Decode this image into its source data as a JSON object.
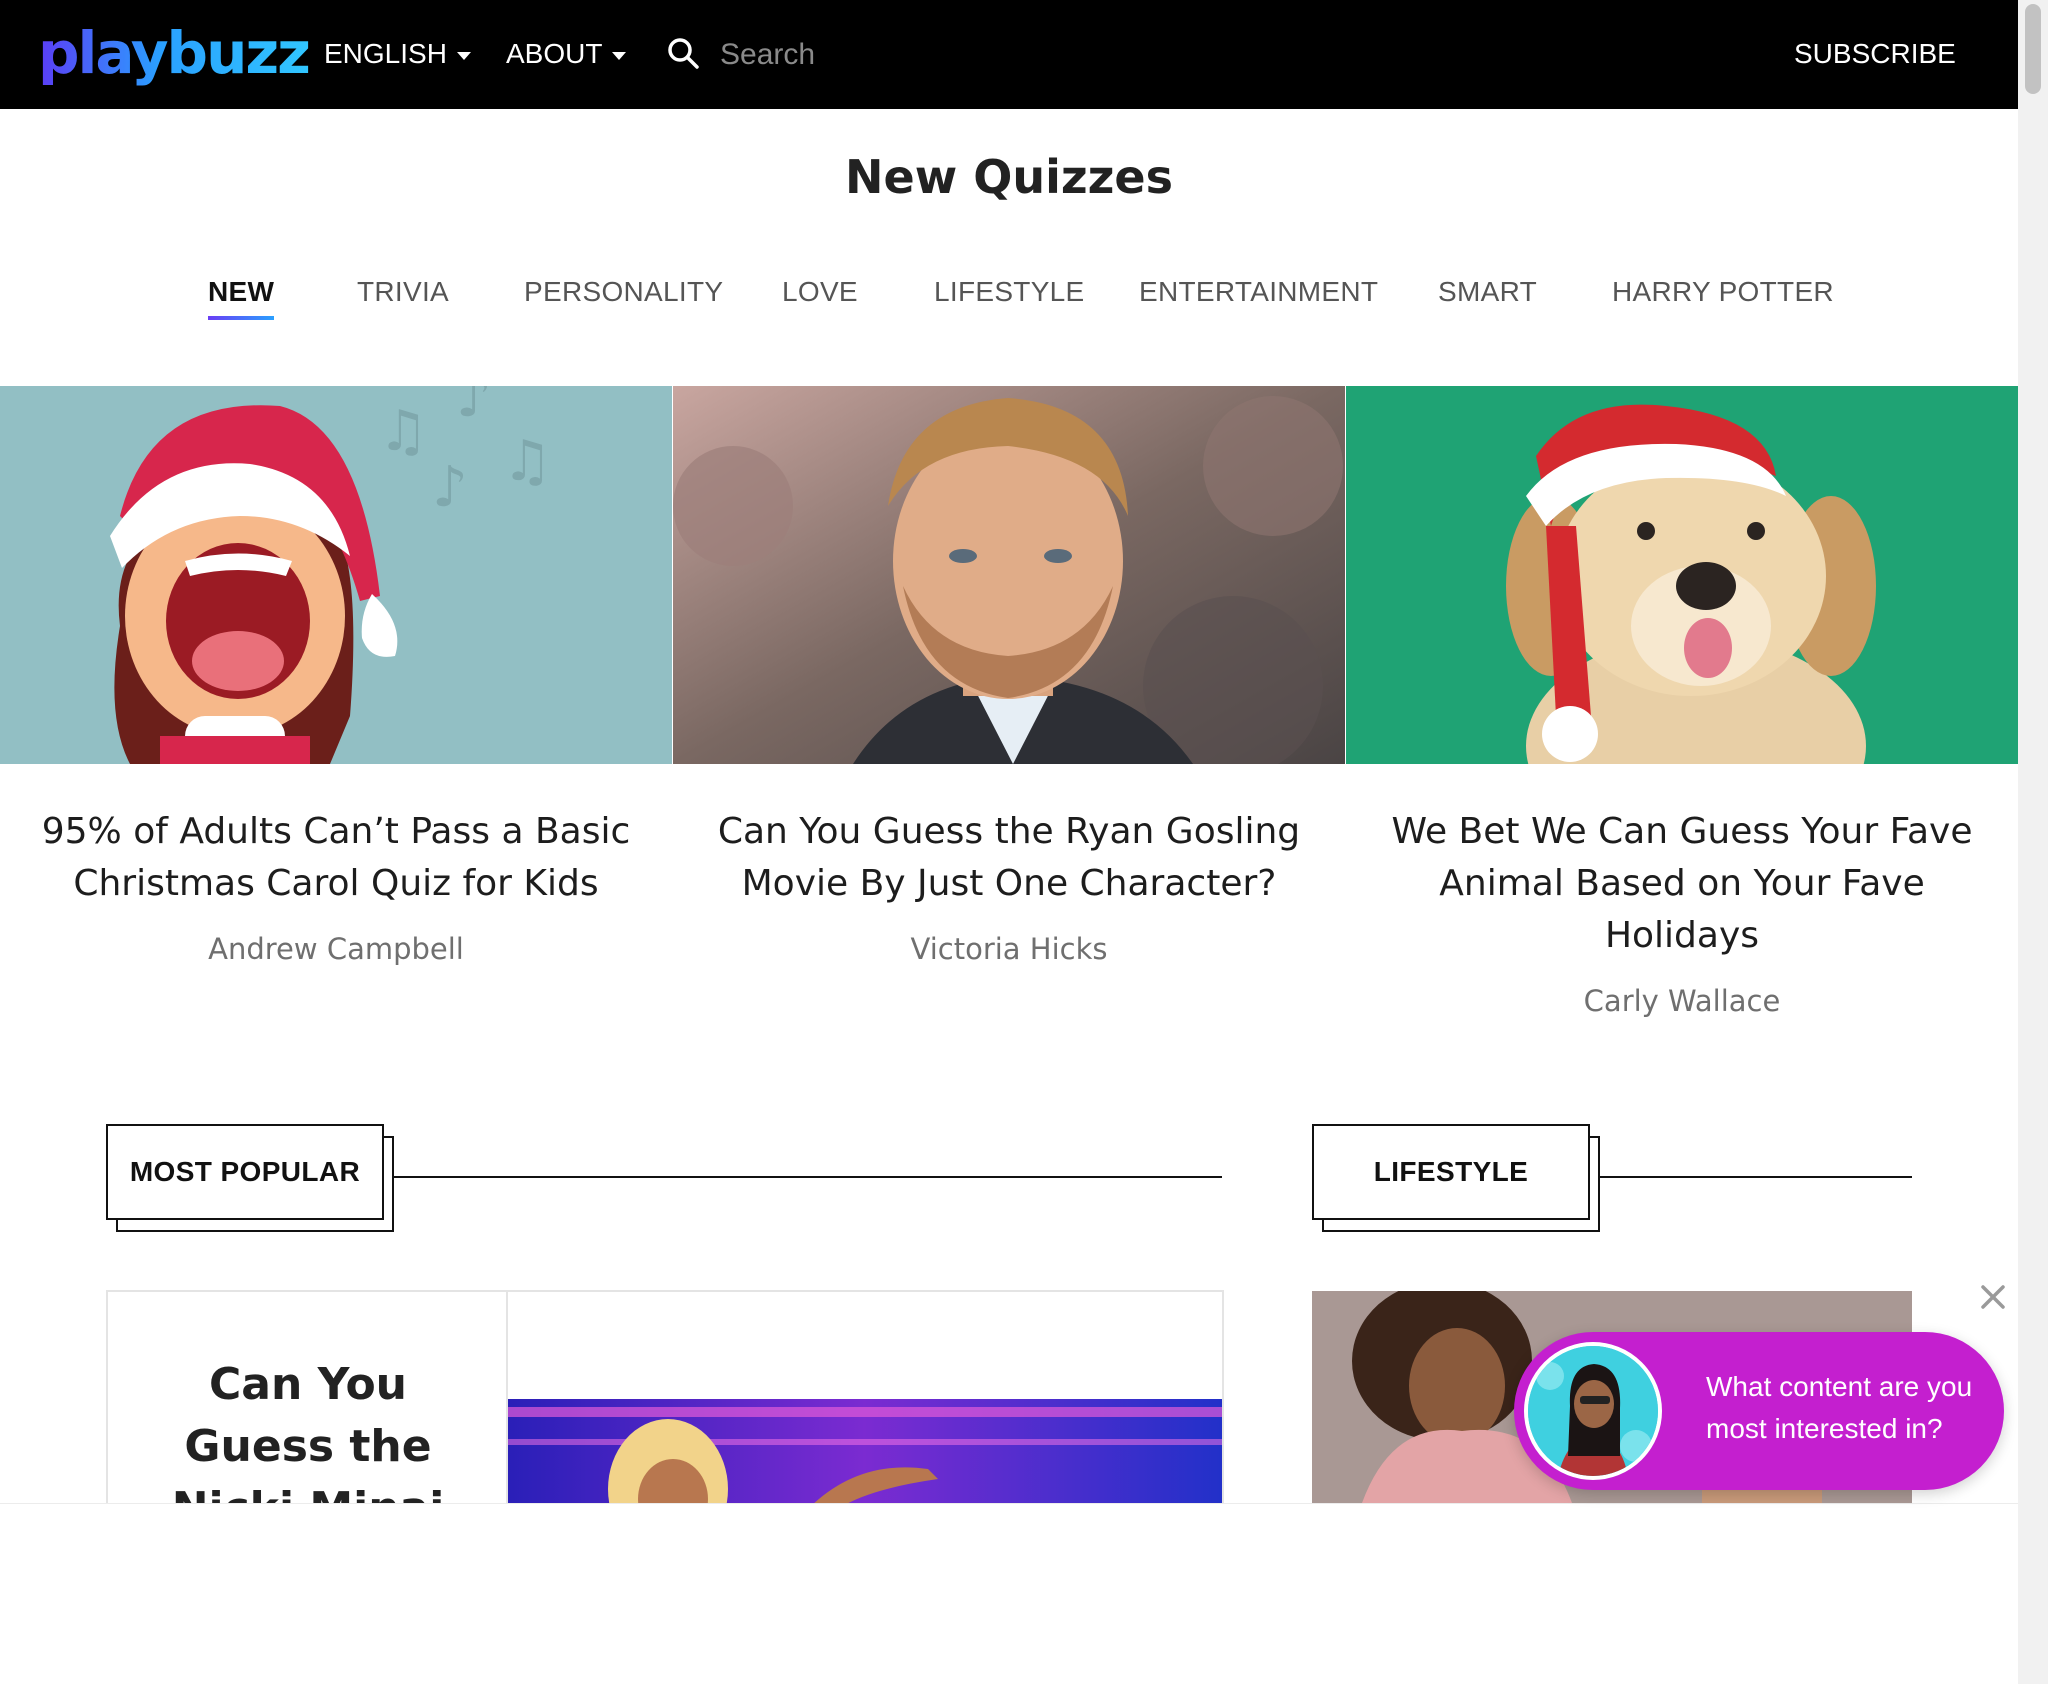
{
  "nav": {
    "logo": "playbuzz",
    "language_label": "ENGLISH",
    "about_label": "ABOUT",
    "search_placeholder": "Search",
    "subscribe_label": "SUBSCRIBE"
  },
  "page_title": "New Quizzes",
  "tabs": [
    {
      "label": "NEW",
      "active": true
    },
    {
      "label": "TRIVIA"
    },
    {
      "label": "PERSONALITY"
    },
    {
      "label": "LOVE"
    },
    {
      "label": "LIFESTYLE"
    },
    {
      "label": "ENTERTAINMENT"
    },
    {
      "label": "SMART"
    },
    {
      "label": "HARRY POTTER"
    }
  ],
  "cards": [
    {
      "title": "95% of Adults Can’t Pass a Basic Christmas Carol Quiz for Kids",
      "author": "Andrew Campbell"
    },
    {
      "title": "Can You Guess the Ryan Gosling Movie By Just One Character?",
      "author": "Victoria Hicks"
    },
    {
      "title": "We Bet We Can Guess Your Fave Animal Based on Your Fave Holidays",
      "author": "Carly Wallace"
    }
  ],
  "sections": {
    "popular_label": "MOST POPULAR",
    "lifestyle_label": "LIFESTYLE"
  },
  "popular_card": {
    "title": "Can You Guess the Nicki Minaj"
  },
  "popup": {
    "text": "What content are you most interested in?"
  },
  "colors": {
    "nav_bg": "#000000",
    "accent_gradient_start": "#6a3df5",
    "accent_gradient_end": "#2aa0ff",
    "popup_bg": "#c41fcf"
  }
}
